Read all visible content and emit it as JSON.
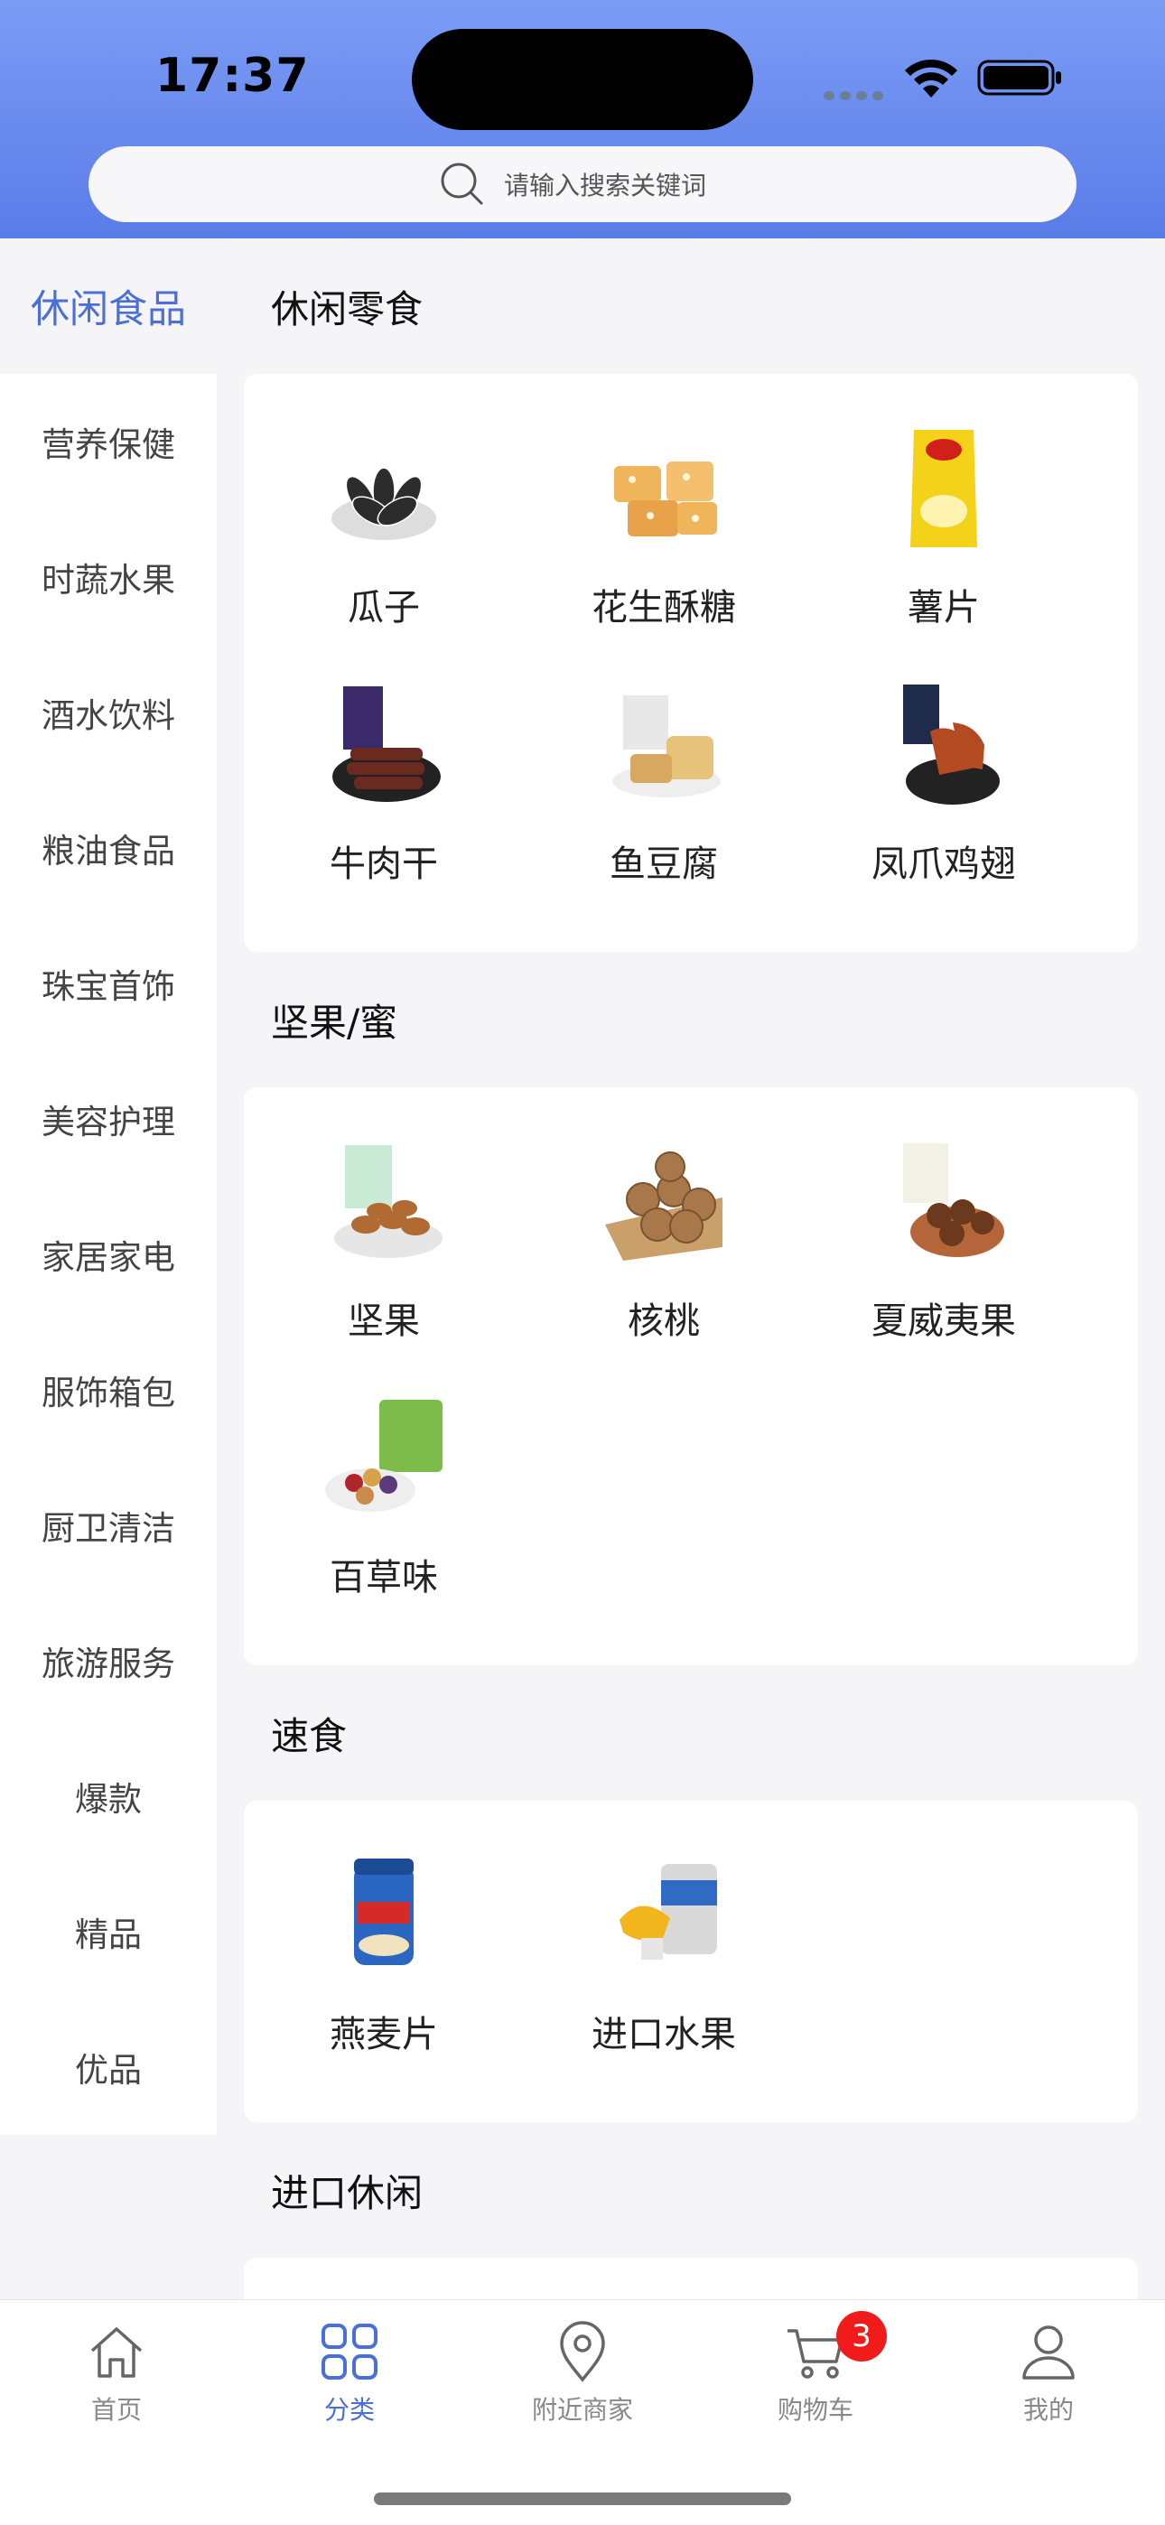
{
  "status": {
    "time": "17:37"
  },
  "search": {
    "placeholder": "请输入搜索关键词"
  },
  "sidebar": {
    "items": [
      {
        "label": "休闲食品",
        "active": true
      },
      {
        "label": "营养保健"
      },
      {
        "label": "时蔬水果"
      },
      {
        "label": "酒水饮料"
      },
      {
        "label": "粮油食品"
      },
      {
        "label": "珠宝首饰"
      },
      {
        "label": "美容护理"
      },
      {
        "label": "家居家电"
      },
      {
        "label": "服饰箱包"
      },
      {
        "label": "厨卫清洁"
      },
      {
        "label": "旅游服务"
      },
      {
        "label": "爆款"
      },
      {
        "label": "精品"
      },
      {
        "label": "优品"
      }
    ]
  },
  "sections": [
    {
      "title": "休闲零食",
      "items": [
        {
          "label": "瓜子",
          "icon": "sunflower-seeds-image"
        },
        {
          "label": "花生酥糖",
          "icon": "peanut-candy-image"
        },
        {
          "label": "薯片",
          "icon": "potato-chips-image"
        },
        {
          "label": "牛肉干",
          "icon": "beef-jerky-image"
        },
        {
          "label": "鱼豆腐",
          "icon": "fish-tofu-image"
        },
        {
          "label": "凤爪鸡翅",
          "icon": "chicken-feet-image"
        }
      ]
    },
    {
      "title": "坚果/蜜",
      "items": [
        {
          "label": "坚果",
          "icon": "nuts-image"
        },
        {
          "label": "核桃",
          "icon": "walnut-image"
        },
        {
          "label": "夏威夷果",
          "icon": "macadamia-image"
        },
        {
          "label": "百草味",
          "icon": "baicaowei-image"
        }
      ]
    },
    {
      "title": "速食",
      "items": [
        {
          "label": "燕麦片",
          "icon": "oatmeal-image"
        },
        {
          "label": "进口水果",
          "icon": "imported-fruit-image"
        }
      ]
    },
    {
      "title": "进口休闲",
      "items": [
        {
          "label": "",
          "icon": "corn-flakes-image"
        },
        {
          "label": "",
          "icon": "snack-box-image"
        }
      ]
    }
  ],
  "tabbar": {
    "tabs": [
      {
        "label": "首页",
        "icon": "home-icon"
      },
      {
        "label": "分类",
        "icon": "category-icon",
        "active": true
      },
      {
        "label": "附近商家",
        "icon": "location-pin-icon"
      },
      {
        "label": "购物车",
        "icon": "cart-icon",
        "badge": "3"
      },
      {
        "label": "我的",
        "icon": "profile-icon"
      }
    ]
  },
  "colors": {
    "accent": "#4a6fd8",
    "header_top": "#7b9cf5",
    "header_bottom": "#5a7ce8",
    "badge": "#f21b1b"
  }
}
